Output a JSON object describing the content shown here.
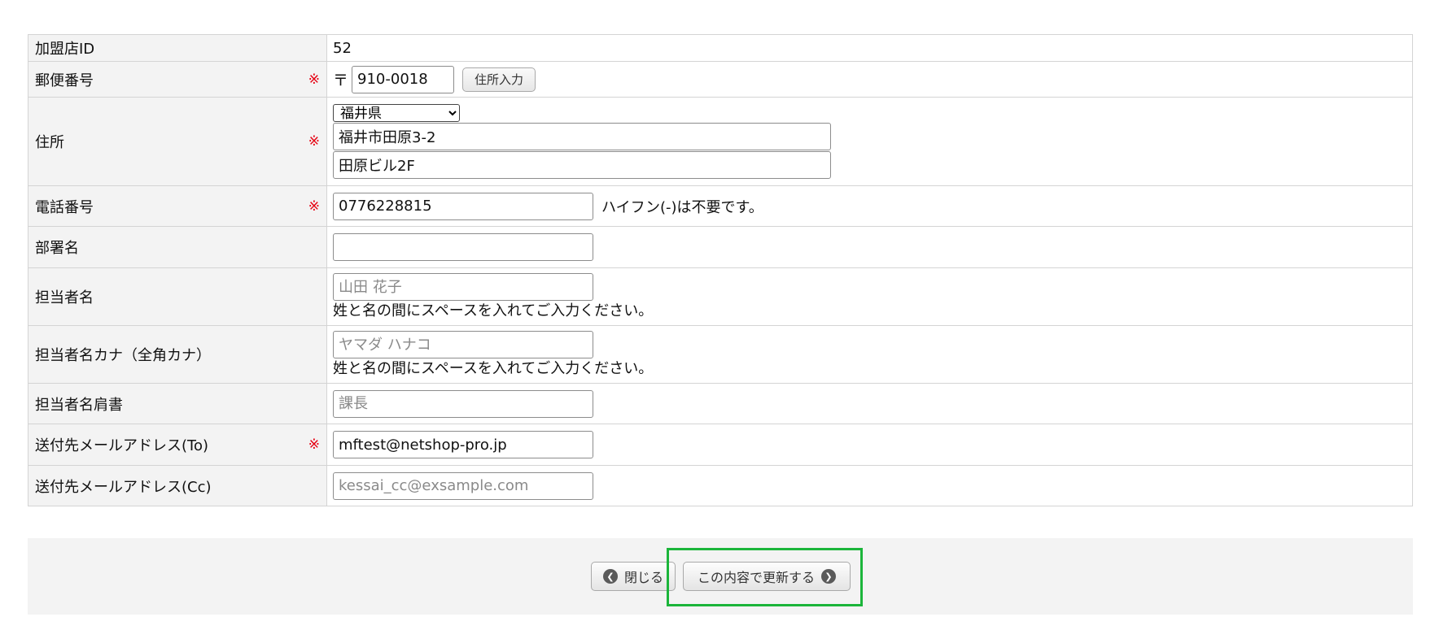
{
  "rows": {
    "merchant_id": {
      "label": "加盟店ID",
      "value": "52"
    },
    "postal": {
      "label": "郵便番号",
      "required_mark": "※",
      "mark": "〒",
      "value": "910-0018",
      "button_label": "住所入力"
    },
    "address": {
      "label": "住所",
      "required_mark": "※",
      "prefecture": "福井県",
      "line1": "福井市田原3-2",
      "line2": "田原ビル2F"
    },
    "phone": {
      "label": "電話番号",
      "required_mark": "※",
      "value": "0776228815",
      "hint": "ハイフン(-)は不要です。"
    },
    "department": {
      "label": "部署名",
      "value": ""
    },
    "contact_name": {
      "label": "担当者名",
      "placeholder": "山田 花子",
      "note": "姓と名の間にスペースを入れてご入力ください。"
    },
    "contact_kana": {
      "label": "担当者名カナ（全角カナ）",
      "placeholder": "ヤマダ ハナコ",
      "note": "姓と名の間にスペースを入れてご入力ください。"
    },
    "contact_title": {
      "label": "担当者名肩書",
      "placeholder": "課長"
    },
    "email_to": {
      "label": "送付先メールアドレス(To)",
      "required_mark": "※",
      "value": "mftest@netshop-pro.jp"
    },
    "email_cc": {
      "label": "送付先メールアドレス(Cc)",
      "placeholder": "kessai_cc@exsample.com"
    }
  },
  "footer": {
    "close_label": "閉じる",
    "update_label": "この内容で更新する",
    "close_icon": "chevron-left-circle-icon",
    "update_icon": "chevron-right-circle-icon"
  },
  "colors": {
    "required": "#e60012",
    "highlight": "#1bb53a",
    "label_bg": "#f3f3f3"
  }
}
